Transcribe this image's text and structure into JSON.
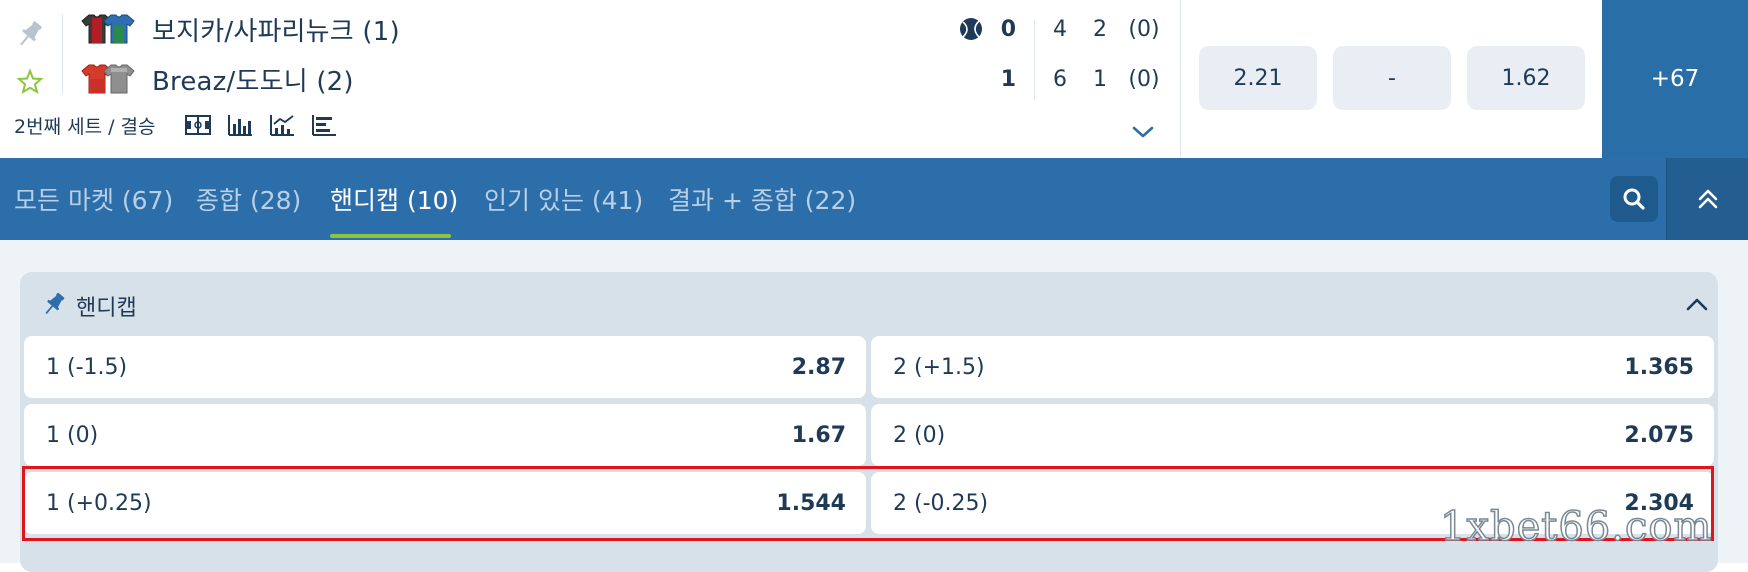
{
  "match": {
    "team1": {
      "name": "보지카/사파리뉴크 (1)",
      "main_score": "0",
      "set1": "4",
      "set2": "2",
      "game": "(0)"
    },
    "team2": {
      "name": "Breaz/도도니 (2)",
      "main_score": "1",
      "set1": "6",
      "set2": "1",
      "game": "(0)"
    },
    "set_label": "2번째 세트 / 결승",
    "stat_icons": [
      "field-icon",
      "bar-chart-icon",
      "trend-chart-icon",
      "list-chart-icon"
    ],
    "jersey_colors": {
      "team1": [
        "#3a3a3a",
        "#2a7a4a"
      ],
      "team2": [
        "#d63a2a",
        "#8a8a8a"
      ]
    }
  },
  "main_odds": {
    "w1": "2.21",
    "x": "-",
    "w2": "1.62",
    "more": "+67"
  },
  "tabs": [
    {
      "label": "모든 마켓 (67)",
      "active": false
    },
    {
      "label": "종합 (28)",
      "active": false
    },
    {
      "label": "핸디캡 (10)",
      "active": true
    },
    {
      "label": "인기 있는 (41)",
      "active": false
    },
    {
      "label": "결과 + 종합 (22)",
      "active": false
    }
  ],
  "market": {
    "title": "핸디캡",
    "rows": [
      {
        "left": {
          "label": "1 (-1.5)",
          "odd": "2.87"
        },
        "right": {
          "label": "2 (+1.5)",
          "odd": "1.365"
        }
      },
      {
        "left": {
          "label": "1 (0)",
          "odd": "1.67"
        },
        "right": {
          "label": "2 (0)",
          "odd": "2.075"
        }
      },
      {
        "left": {
          "label": "1 (+0.25)",
          "odd": "1.544"
        },
        "right": {
          "label": "2 (-0.25)",
          "odd": "2.304"
        }
      }
    ]
  },
  "watermark": "1xbet66.com",
  "colors": {
    "tab_bar": "#2b6ea9",
    "active_underline": "#8cc63f",
    "highlight": "#e0141b",
    "text": "#1f3a57"
  }
}
